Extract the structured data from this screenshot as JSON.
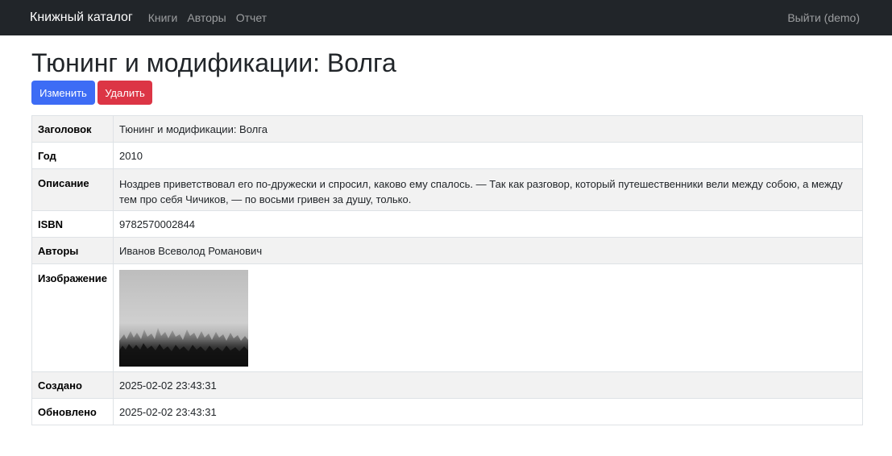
{
  "navbar": {
    "brand": "Книжный каталог",
    "links": [
      "Книги",
      "Авторы",
      "Отчет"
    ],
    "logout": "Выйти (demo)"
  },
  "page": {
    "title": "Тюнинг и модификации: Волга"
  },
  "actions": {
    "edit_label": "Изменить",
    "delete_label": "Удалить"
  },
  "colors": {
    "navbar_bg": "#212529",
    "primary": "#3d6cf5",
    "danger": "#dc3545"
  },
  "details": {
    "title_label": "Заголовок",
    "title_value": "Тюнинг и модификации: Волга",
    "year_label": "Год",
    "year_value": "2010",
    "description_label": "Описание",
    "description_value": "Ноздрев приветствовал его по-дружески и спросил, каково ему спалось. — Так как разговор, который путешественники вели между собою, а между тем про себя Чичиков, — по восьми гривен за душу, только.",
    "isbn_label": "ISBN",
    "isbn_value": "9782570002844",
    "authors_label": "Авторы",
    "authors_value": "Иванов Всеволод Романович",
    "image_label": "Изображение",
    "created_label": "Создано",
    "created_value": "2025-02-02 23:43:31",
    "updated_label": "Обновлено",
    "updated_value": "2025-02-02 23:43:31"
  }
}
